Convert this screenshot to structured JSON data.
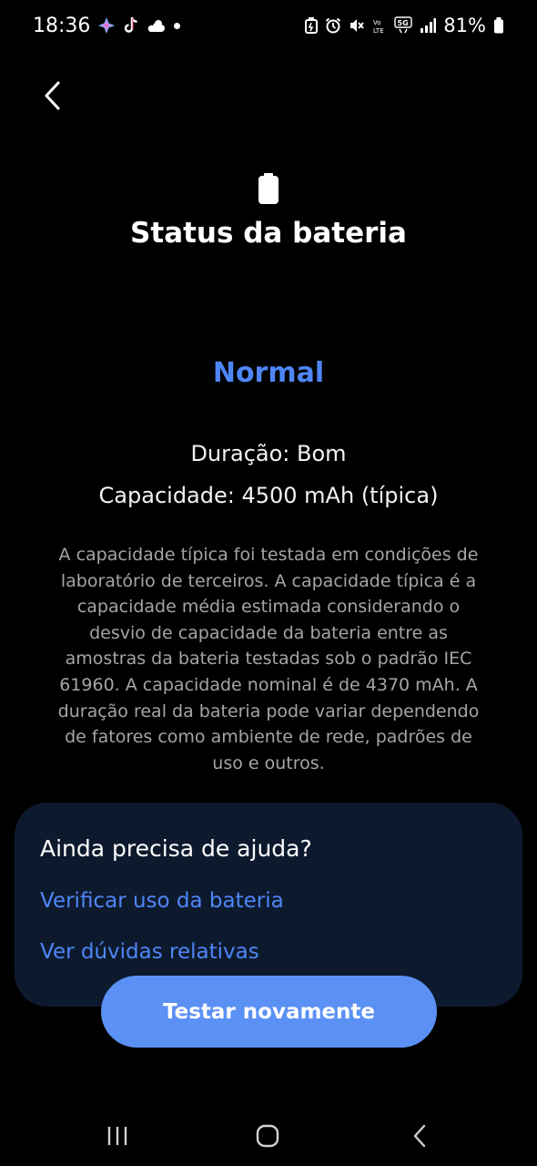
{
  "status_bar": {
    "time": "18:36",
    "battery_percent": "81%",
    "left_icons": [
      "sparkle-icon",
      "tiktok-icon",
      "weather-icon",
      "notification-dot-icon"
    ],
    "right_icons": [
      "battery-saver-icon",
      "alarm-icon",
      "mute-icon",
      "volte-icon",
      "5g-icon",
      "signal-icon",
      "battery-icon"
    ],
    "network_label": "5G"
  },
  "header": {
    "back_icon": "chevron-left-icon",
    "title": "Status da bateria",
    "battery_icon": "battery-icon"
  },
  "status": {
    "value": "Normal",
    "duration": "Duração: Bom",
    "capacity": "Capacidade: 4500 mAh (típica)",
    "description": "A capacidade típica foi testada em condições de laboratório de terceiros. A capacidade típica é a capacidade média estimada considerando o desvio de capacidade da bateria entre as amostras da bateria testadas sob o padrão IEC 61960. A capacidade nominal é de 4370 mAh. A duração real da bateria pode variar dependendo de fatores como ambiente de rede, padrões de uso e outros."
  },
  "help": {
    "title": "Ainda precisa de ajuda?",
    "links": [
      "Verificar uso da bateria",
      "Ver dúvidas relativas"
    ]
  },
  "actions": {
    "retest_label": "Testar novamente"
  },
  "navigation": {
    "buttons": [
      "recent-apps-icon",
      "home-icon",
      "back-icon"
    ]
  },
  "colors": {
    "background": "#000000",
    "accent": "#4f86f7",
    "card": "#0d1a2e",
    "button": "#5b91f5"
  }
}
